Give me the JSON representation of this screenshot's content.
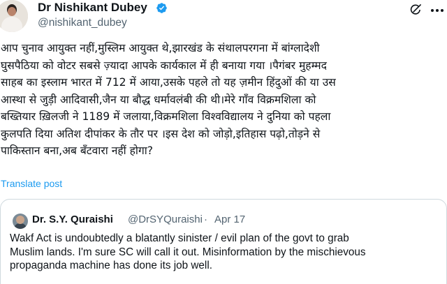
{
  "author": {
    "display_name": "Dr Nishikant Dubey",
    "handle": "@nishikant_dubey",
    "verified_icon": "verified-badge-icon",
    "badge_color": "#1d9bf0"
  },
  "icons": {
    "grok": "grok-icon",
    "more": "more-options-icon"
  },
  "post": {
    "lines": [
      "आप चुनाव आयुक्त नहीं,मुस्लिम आयुक्त थे,झारखंड के संथालपरगना में बांग्लादेशी",
      "घुसपैठिया को वोटर सबसे ज़्यादा आपके कार्यकाल में ही बनाया गया ।पैगंबर मुहम्मद",
      "साहब  का इस्लाम भारत में 712 में आया,उसके पहले तो यह ज़मीन हिंदुओं की या उस",
      "आस्था से जुड़ी आदिवासी,जैन या बौद्ध धर्मावलंबी की थी।मेरे गाँव विक्रमशिला को",
      "बख्तियार ख़िलजी ने 1189 में जलाया,विक्रमशिला विश्वविद्यालय ने दुनिया को पहला",
      "कुलपति दिया अतिश दीपांकर के तौर पर ।इस देश को जोड़ो,इतिहास पढ़ो,तोड़ने से",
      "पाकिस्तान बना,अब बँटवारा नहीं होगा?"
    ],
    "translate_label": "Translate post"
  },
  "quote": {
    "display_name": "Dr. S.Y. Quraishi",
    "handle": "@DrSYQuraishi",
    "separator": "·",
    "date": "Apr 17",
    "lines": [
      "Wakf Act is undoubtedly a blatantly sinister / evil plan of the govt to grab",
      "Muslim lands. I'm sure SC will call it out. Misinformation by the mischievous",
      "propaganda machine has done its job well."
    ]
  },
  "colors": {
    "text": "#0f1419",
    "secondary": "#536471",
    "link": "#1d9bf0",
    "border": "#cfd9de"
  }
}
